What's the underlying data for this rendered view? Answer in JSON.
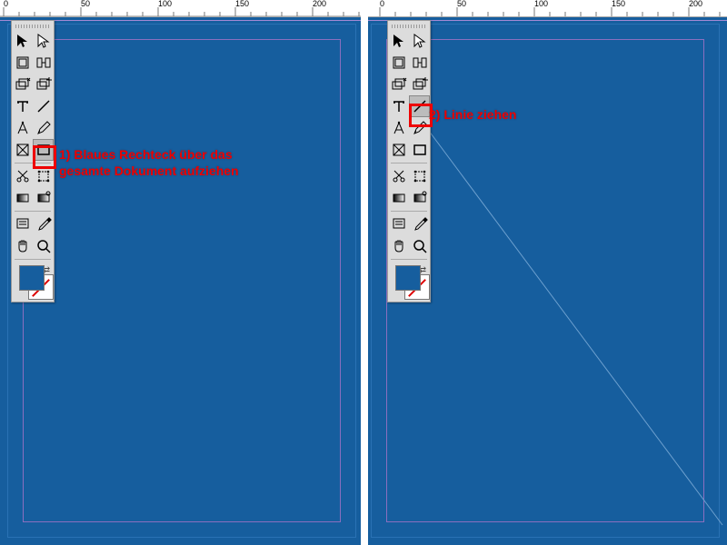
{
  "ruler": {
    "ticks": [
      0,
      50,
      100,
      150,
      200
    ],
    "spacing_px": 85
  },
  "annotations": {
    "left": "1) Blaues Rechteck über das\ngesamte Dokument aufziehen",
    "right": "2) Linie ziehen"
  },
  "tools": {
    "rows": [
      [
        "selection",
        "direct-selection"
      ],
      [
        "page",
        "gap"
      ],
      [
        "content-collector",
        "content-placer"
      ],
      [
        "type",
        "line"
      ],
      [
        "pen",
        "pencil"
      ],
      [
        "frame-rect",
        "rectangle"
      ],
      [
        "scissors",
        "free-transform"
      ],
      [
        "gradient-swatch",
        "gradient-feather"
      ],
      [
        "note",
        "eyedropper"
      ],
      [
        "hand",
        "zoom"
      ]
    ],
    "selected_left": "rectangle",
    "selected_right": "line"
  },
  "colors": {
    "canvas_bg": "#165e9e",
    "margin_guide": "#8a6fbf",
    "annotation": "#e00",
    "fill_swatch": "#165e9e",
    "stroke_swatch": "none"
  },
  "highlight": {
    "left": {
      "tool": "rectangle",
      "row": 5,
      "col": 1
    },
    "right": {
      "tool": "line",
      "row": 3,
      "col": 1
    }
  }
}
